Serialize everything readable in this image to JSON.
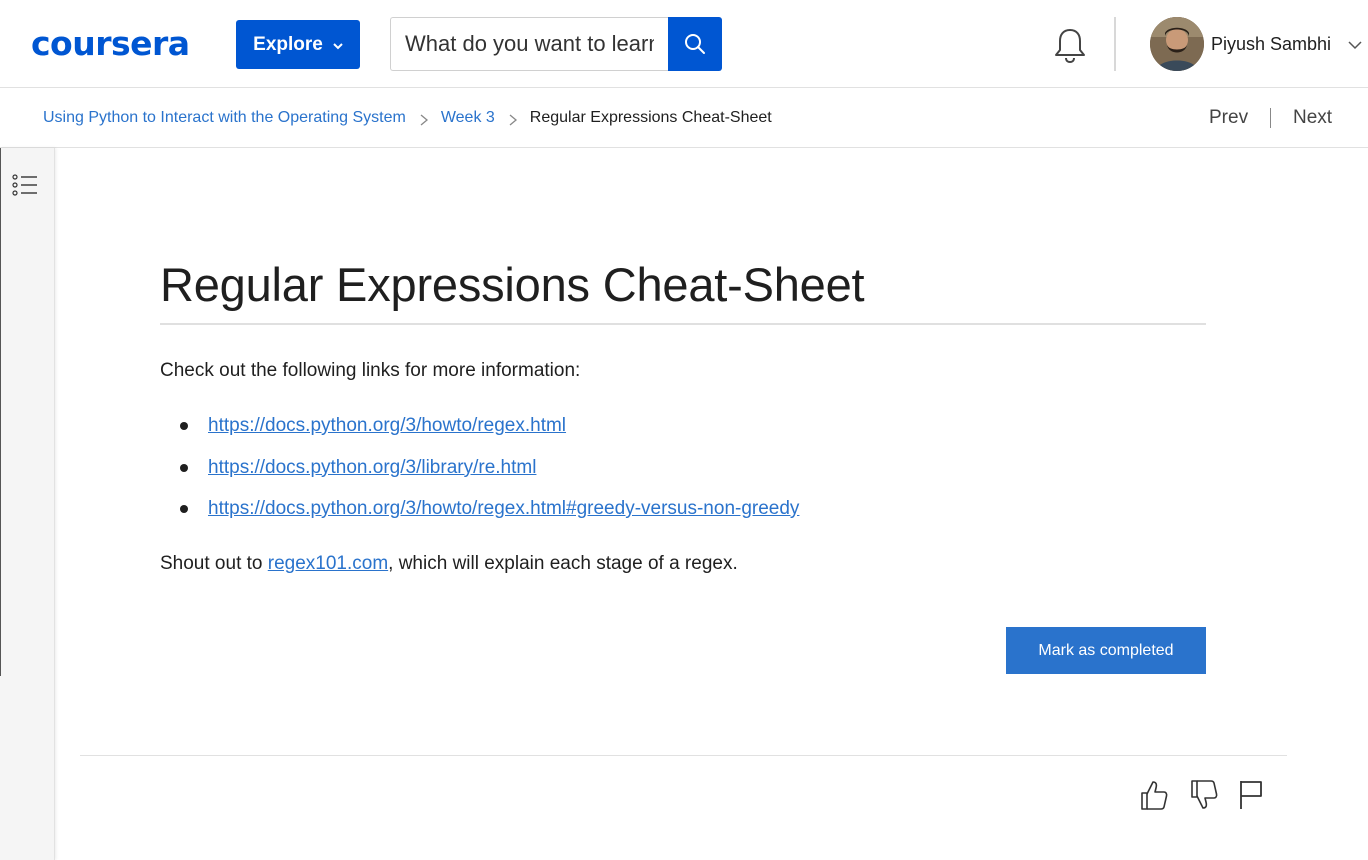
{
  "header": {
    "logo_text": "coursera",
    "explore_label": "Explore",
    "search_placeholder": "What do you want to learn?",
    "user_name": "Piyush Sambhi",
    "brand_color": "#0056d2"
  },
  "breadcrumb": {
    "items": [
      {
        "label": "Using Python to Interact with the Operating System"
      },
      {
        "label": "Week 3"
      },
      {
        "label": "Regular Expressions Cheat-Sheet"
      }
    ],
    "prev_label": "Prev",
    "next_label": "Next"
  },
  "content": {
    "title": "Regular Expressions Cheat-Sheet",
    "intro": "Check out the following links for more information:",
    "links": [
      "https://docs.python.org/3/howto/regex.html",
      "https://docs.python.org/3/library/re.html",
      "https://docs.python.org/3/howto/regex.html#greedy-versus-non-greedy"
    ],
    "shoutout_prefix": "Shout out to ",
    "shoutout_link": "regex101.com",
    "shoutout_suffix": ", which will explain each stage of a regex.",
    "complete_button": "Mark as completed",
    "link_color": "#2a73cc"
  },
  "icons": {
    "toc": "table-of-contents-icon",
    "bell": "bell-icon",
    "search": "search-icon",
    "like": "thumbs-up-icon",
    "dislike": "thumbs-down-icon",
    "flag": "flag-icon"
  }
}
